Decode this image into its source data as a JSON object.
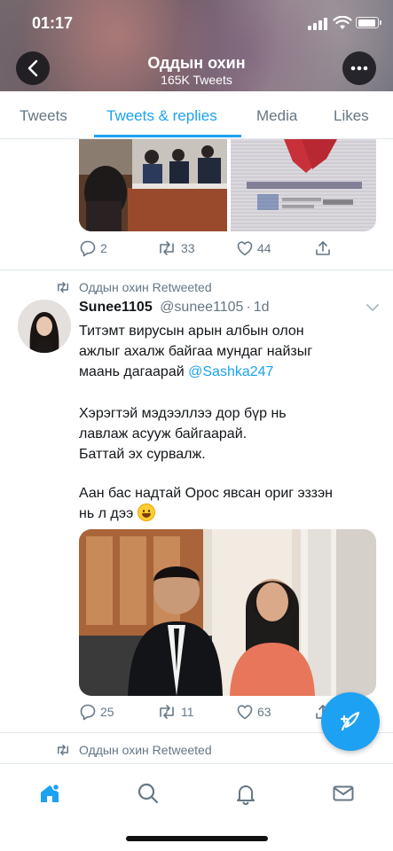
{
  "status_bar": {
    "time": "01:17",
    "battery_level": 0.9
  },
  "header": {
    "title": "Оддын охин",
    "subtitle": "165K Tweets",
    "back_icon": "chevron-left-icon",
    "more_icon": "more-horizontal-icon"
  },
  "tabs": [
    {
      "label": "Tweets",
      "active": false
    },
    {
      "label": "Tweets & replies",
      "active": true
    },
    {
      "label": "Media",
      "active": false
    },
    {
      "label": "Likes",
      "active": false
    }
  ],
  "tweets": [
    {
      "images": [
        "meeting-photo",
        "document-photo"
      ],
      "actions": {
        "replies": "2",
        "retweets": "33",
        "likes": "44"
      }
    },
    {
      "retweeted_by": "Оддын охин Retweeted",
      "name": "Sunee1105",
      "handle": "@sunee1105",
      "separator": "·",
      "time": "1d",
      "text_lines": [
        "Титэмт вирусын арын албын олон",
        "ажлыг ахалж байгаа мундаг найзыг",
        "маань дагаарай"
      ],
      "mention": "@Sashka247",
      "paragraph2": [
        "Хэрэгтэй мэдээллээ дор бүр нь",
        "лавлаж асууж байгаарай.",
        "Баттай эх сурвалж."
      ],
      "paragraph3": [
        "Аан бас надтай Орос явсан ориг эззэн",
        "нь л дээ"
      ],
      "emoji": "grinning-face",
      "image": "couple-photo",
      "actions": {
        "replies": "25",
        "retweets": "11",
        "likes": "63"
      }
    },
    {
      "retweeted_by": "Оддын охин Retweeted"
    }
  ],
  "bottom_nav": [
    {
      "icon": "home-icon",
      "active": true
    },
    {
      "icon": "search-icon",
      "active": false
    },
    {
      "icon": "bell-icon",
      "active": false
    },
    {
      "icon": "mail-icon",
      "active": false
    }
  ],
  "fab_icon": "compose-tweet-icon",
  "colors": {
    "accent": "#1da1f2",
    "text": "#14171a",
    "muted": "#657786",
    "border": "#e1e8ed"
  }
}
